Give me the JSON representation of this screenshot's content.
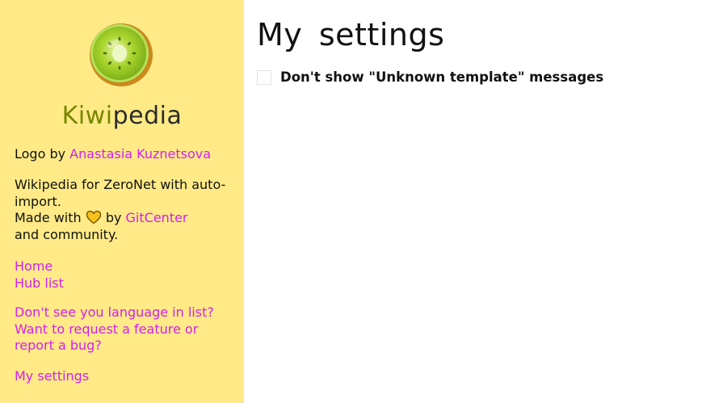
{
  "sidebar": {
    "brand_part1": "Kiwi",
    "brand_part2": "pedia",
    "logo_credit_prefix": "Logo by ",
    "logo_credit_author": "Anastasia Kuznetsova",
    "description_line1": "Wikipedia for ZeroNet with auto-import.",
    "made_with_prefix": "Made with ",
    "made_with_by": " by ",
    "made_with_link": "GitCenter",
    "made_with_suffix": "and community.",
    "nav": {
      "home": "Home",
      "hub_list": "Hub list"
    },
    "feedback": {
      "line1": "Don't see you language in list?",
      "line2": "Want to request a feature or report a bug?"
    },
    "my_settings": "My settings",
    "colors": {
      "background": "#ffea87",
      "link": "#d61fe8",
      "brand_kiwi": "#788600"
    }
  },
  "main": {
    "title": "My settings",
    "settings": [
      {
        "label": "Don't show \"Unknown template\" messages",
        "checked": false
      }
    ]
  },
  "icons": {
    "logo": "kiwi-fruit-logo",
    "heart": "heart-icon"
  }
}
